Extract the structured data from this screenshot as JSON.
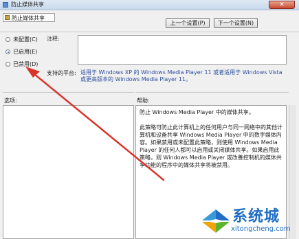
{
  "window": {
    "title": "防止媒体共享"
  },
  "policy_name": "防止媒体共享",
  "nav": {
    "prev_label": "上一个设置(P)",
    "next_label": "下一个设置(N)"
  },
  "options": [
    {
      "label": "未配置(C)",
      "selected": false
    },
    {
      "label": "已启用(E)",
      "selected": true
    },
    {
      "label": "已禁用(D)",
      "selected": false
    }
  ],
  "comment_label": "注释:",
  "platform": {
    "label": "支持的平台:",
    "text": "适用于 Windows XP 的 Windows Media Player 11 或者适用于 Windows Vista 或更高版本的 Windows Media Player 11。"
  },
  "options_header": "选项:",
  "help": {
    "header": "帮助:",
    "title": "防止 Windows Media Player 中的媒体共享。",
    "body": "此策略可防止此计算机上的任何用户与同一网络中的其他计算机和设备共享 Windows Media Player 中的数字媒体内容。如果禁用或未配置此策略，则使用 Windows Media Player 的任何人都可以启用或关闭媒体共享。如果启用此策略，则 Windows Media Player 或改善控制机的媒体共享功能的程序中的媒体共享将被禁用。"
  },
  "watermark": {
    "name": "系统城",
    "url": "xitongcheng.com"
  },
  "colors": {
    "arrow": "#d9342b",
    "link_text": "#2d4fa0",
    "brand": "#1f6ec4"
  }
}
